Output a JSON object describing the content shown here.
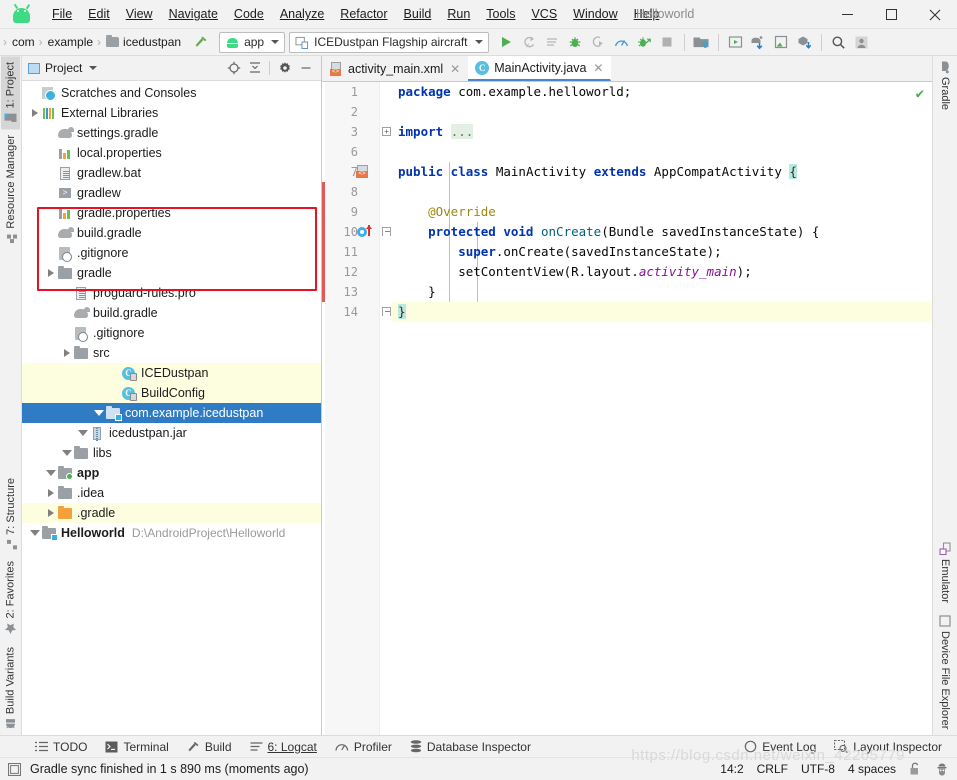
{
  "window": {
    "title": "Helloworld",
    "minimize_label": "—",
    "maximize_label": "□",
    "close_label": "✕"
  },
  "menu": {
    "items": [
      {
        "label": "File"
      },
      {
        "label": "Edit"
      },
      {
        "label": "View"
      },
      {
        "label": "Navigate"
      },
      {
        "label": "Code"
      },
      {
        "label": "Analyze"
      },
      {
        "label": "Refactor"
      },
      {
        "label": "Build"
      },
      {
        "label": "Run"
      },
      {
        "label": "Tools"
      },
      {
        "label": "VCS"
      },
      {
        "label": "Window"
      },
      {
        "label": "Help"
      }
    ]
  },
  "navbar": {
    "breadcrumbs": [
      "com",
      "example",
      "icedustpan"
    ],
    "separator": "›",
    "module_selector": "app",
    "device_selector": "ICEDustpan Flagship aircraft",
    "icons": [
      "run-icon",
      "apply-changes-icon",
      "apply-code-changes-icon",
      "debug-icon",
      "attach-debugger-icon",
      "profiler-icon",
      "run-with-coverage-icon",
      "stop-icon",
      "sdk-manager-icon",
      "avd-manager-icon",
      "sync-gradle-icon",
      "device-manager-icon",
      "sdk-update-icon",
      "search-icon",
      "profile-icon"
    ]
  },
  "left_strip": {
    "tabs": [
      {
        "label": "1: Project",
        "icon": "project-icon",
        "active": true
      },
      {
        "label": "Resource Manager",
        "icon": "resource-manager-icon",
        "active": false
      },
      {
        "label": "7: Structure",
        "icon": "structure-icon",
        "active": false
      },
      {
        "label": "2: Favorites",
        "icon": "star-icon",
        "active": false
      },
      {
        "label": "Build Variants",
        "icon": "android-variants-icon",
        "active": false
      }
    ]
  },
  "right_strip": {
    "top_tabs": [
      {
        "label": "Gradle",
        "icon": "gradle-elephant-icon"
      }
    ],
    "bottom_tabs": [
      {
        "label": "Emulator",
        "icon": "emulator-icon"
      },
      {
        "label": "Device File Explorer",
        "icon": "device-file-explorer-icon"
      }
    ]
  },
  "project_panel": {
    "title": "Project",
    "header_icons": [
      "locate-icon",
      "collapse-all-icon",
      "settings-gear-icon",
      "hide-icon"
    ],
    "tree": [
      {
        "indent": 0,
        "twisty": "down",
        "icon": "project-folder-icon",
        "label": "Helloworld",
        "path": "D:\\AndroidProject\\Helloworld",
        "bold": true,
        "state": "none"
      },
      {
        "indent": 1,
        "twisty": "right",
        "icon": "folder-orange-icon",
        "label": ".gradle",
        "state": "hl"
      },
      {
        "indent": 1,
        "twisty": "right",
        "icon": "folder-grey-icon",
        "label": ".idea",
        "state": "none"
      },
      {
        "indent": 1,
        "twisty": "down",
        "icon": "module-folder-icon",
        "label": "app",
        "bold": true,
        "state": "none"
      },
      {
        "indent": 2,
        "twisty": "down",
        "icon": "folder-grey-icon",
        "label": "libs",
        "state": "none"
      },
      {
        "indent": 3,
        "twisty": "down",
        "icon": "jar-icon",
        "label": "icedustpan.jar",
        "state": "none"
      },
      {
        "indent": 4,
        "twisty": "down",
        "icon": "package-folder-icon",
        "label": "com.example.icedustpan",
        "state": "selected"
      },
      {
        "indent": 5,
        "twisty": "none",
        "icon": "class-icon",
        "label": "BuildConfig",
        "state": "hl"
      },
      {
        "indent": 5,
        "twisty": "none",
        "icon": "class-icon",
        "label": "ICEDustpan",
        "state": "hl"
      },
      {
        "indent": 2,
        "twisty": "right",
        "icon": "folder-grey-icon",
        "label": "src",
        "state": "none"
      },
      {
        "indent": 2,
        "twisty": "none",
        "icon": "gitignore-icon",
        "label": ".gitignore",
        "state": "none"
      },
      {
        "indent": 2,
        "twisty": "none",
        "icon": "gradle-file-icon",
        "label": "build.gradle",
        "state": "none"
      },
      {
        "indent": 2,
        "twisty": "none",
        "icon": "text-file-icon",
        "label": "proguard-rules.pro",
        "state": "none"
      },
      {
        "indent": 1,
        "twisty": "right",
        "icon": "folder-grey-icon",
        "label": "gradle",
        "state": "none"
      },
      {
        "indent": 1,
        "twisty": "none",
        "icon": "gitignore-icon",
        "label": ".gitignore",
        "state": "none"
      },
      {
        "indent": 1,
        "twisty": "none",
        "icon": "gradle-file-icon",
        "label": "build.gradle",
        "state": "none"
      },
      {
        "indent": 1,
        "twisty": "none",
        "icon": "properties-file-icon",
        "label": "gradle.properties",
        "state": "none"
      },
      {
        "indent": 1,
        "twisty": "none",
        "icon": "shell-script-icon",
        "label": "gradlew",
        "state": "none"
      },
      {
        "indent": 1,
        "twisty": "none",
        "icon": "text-file-icon",
        "label": "gradlew.bat",
        "state": "none"
      },
      {
        "indent": 1,
        "twisty": "none",
        "icon": "properties-file-icon",
        "label": "local.properties",
        "state": "none"
      },
      {
        "indent": 1,
        "twisty": "none",
        "icon": "gradle-file-icon",
        "label": "settings.gradle",
        "state": "none"
      },
      {
        "indent": 0,
        "twisty": "right",
        "icon": "external-libraries-icon",
        "label": "External Libraries",
        "state": "none"
      },
      {
        "indent": 0,
        "twisty": "none",
        "icon": "scratches-icon",
        "label": "Scratches and Consoles",
        "state": "none"
      }
    ]
  },
  "editor": {
    "tabs": [
      {
        "label": "activity_main.xml",
        "icon": "xml-layout-icon",
        "active": false,
        "close": "✕"
      },
      {
        "label": "MainActivity.java",
        "icon": "java-class-icon",
        "active": true,
        "close": "✕"
      }
    ],
    "line_numbers": [
      "1",
      "2",
      "3",
      "6",
      "7",
      "8",
      "9",
      "10",
      "11",
      "12",
      "13",
      "14"
    ],
    "inspection_status": "✔",
    "code_lines": [
      {
        "num": "1",
        "tokens": [
          {
            "t": "package ",
            "c": "kw"
          },
          {
            "t": "com.example.helloworld;",
            "c": "plain"
          }
        ]
      },
      {
        "num": "2",
        "tokens": []
      },
      {
        "num": "3",
        "tokens": [
          {
            "t": "import ",
            "c": "kw"
          },
          {
            "t": "...",
            "c": "foldph"
          }
        ]
      },
      {
        "num": "6",
        "tokens": []
      },
      {
        "num": "7",
        "tokens": [
          {
            "t": "public class ",
            "c": "kw"
          },
          {
            "t": "MainActivity ",
            "c": "plain"
          },
          {
            "t": "extends ",
            "c": "kw"
          },
          {
            "t": "AppCompatActivity ",
            "c": "plain"
          },
          {
            "t": "{",
            "c": "brc"
          }
        ]
      },
      {
        "num": "8",
        "tokens": []
      },
      {
        "num": "9",
        "tokens": [
          {
            "t": "    @Override",
            "c": "anno"
          }
        ]
      },
      {
        "num": "10",
        "tokens": [
          {
            "t": "    protected void ",
            "c": "kw"
          },
          {
            "t": "onCreate",
            "c": "fn"
          },
          {
            "t": "(Bundle savedInstanceState) {",
            "c": "plain"
          }
        ]
      },
      {
        "num": "11",
        "tokens": [
          {
            "t": "        ",
            "c": "plain"
          },
          {
            "t": "super",
            "c": "kw"
          },
          {
            "t": ".onCreate(savedInstanceState);",
            "c": "plain"
          }
        ]
      },
      {
        "num": "12",
        "tokens": [
          {
            "t": "        setContentView(R.layout.",
            "c": "plain"
          },
          {
            "t": "activity_main",
            "c": "fld"
          },
          {
            "t": ");",
            "c": "plain"
          }
        ]
      },
      {
        "num": "13",
        "tokens": [
          {
            "t": "    }",
            "c": "plain"
          }
        ]
      },
      {
        "num": "14",
        "tokens": [
          {
            "t": "}",
            "c": "brc"
          }
        ],
        "highlight": true
      }
    ]
  },
  "bottom_bar": {
    "items": [
      {
        "label": "TODO",
        "icon": "todo-icon"
      },
      {
        "label": "Terminal",
        "icon": "terminal-icon"
      },
      {
        "label": "Build",
        "icon": "build-hammer-icon"
      },
      {
        "label": "6: Logcat",
        "icon": "logcat-icon"
      },
      {
        "label": "Profiler",
        "icon": "profiler-icon"
      },
      {
        "label": "Database Inspector",
        "icon": "database-icon"
      }
    ],
    "right_items": [
      {
        "label": "Event Log",
        "icon": "event-log-icon"
      },
      {
        "label": "Layout Inspector",
        "icon": "layout-inspector-icon"
      }
    ]
  },
  "status_bar": {
    "message": "Gradle sync finished in 1 s 890 ms (moments ago)",
    "caret_position": "14:2",
    "line_separator": "CRLF",
    "encoding": "UTF-8",
    "indent": "4 spaces",
    "lock_icon": "unlocked-icon",
    "inspector_icon": "inspection-profile-icon",
    "watermark": "https://blog.csdn.net/weixin_42265779"
  },
  "colors": {
    "accent_blue": "#2f7cc4",
    "highlight_yellow": "#fdfde0",
    "red_box": "#e81123",
    "android_green": "#3ddc84",
    "keyword_blue": "#0033b3",
    "field_purple": "#871094",
    "annotation_olive": "#9e880d",
    "method_teal": "#00627a"
  }
}
